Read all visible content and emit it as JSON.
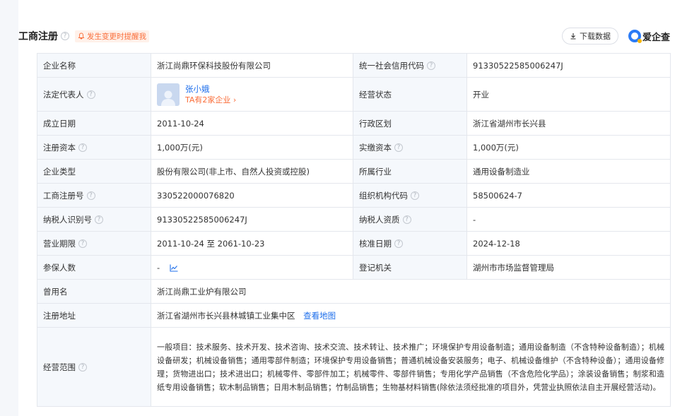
{
  "header": {
    "title": "工商注册",
    "alert": "发生变更时提醒我",
    "download_label": "下载数据",
    "brand": "爱企查"
  },
  "fields": {
    "company_name_label": "企业名称",
    "company_name": "浙江尚鼎环保科技股份有限公司",
    "credit_code_label": "统一社会信用代码",
    "credit_code": "91330522585006247J",
    "legal_rep_label": "法定代表人",
    "legal_rep_name": "张小娥",
    "legal_rep_companies": "TA有2家企业 ›",
    "status_label": "经营状态",
    "status": "开业",
    "founded_label": "成立日期",
    "founded": "2011-10-24",
    "region_label": "行政区划",
    "region": "浙江省湖州市长兴县",
    "reg_capital_label": "注册资本",
    "reg_capital": "1,000万(元)",
    "paid_capital_label": "实缴资本",
    "paid_capital": "1,000万(元)",
    "type_label": "企业类型",
    "type": "股份有限公司(非上市、自然人投资或控股)",
    "industry_label": "所属行业",
    "industry": "通用设备制造业",
    "reg_no_label": "工商注册号",
    "reg_no": "330522000076820",
    "org_code_label": "组织机构代码",
    "org_code": "58500624-7",
    "tax_id_label": "纳税人识别号",
    "tax_id": "91330522585006247J",
    "taxpayer_qual_label": "纳税人资质",
    "taxpayer_qual": "-",
    "term_label": "营业期限",
    "term": "2011-10-24 至 2061-10-23",
    "approval_label": "核准日期",
    "approval": "2024-12-18",
    "insured_label": "参保人数",
    "insured": "-",
    "authority_label": "登记机关",
    "authority": "湖州市市场监督管理局",
    "former_name_label": "曾用名",
    "former_name": "浙江尚鼎工业炉有限公司",
    "address_label": "注册地址",
    "address": "浙江省湖州市长兴县林城镇工业集中区",
    "map_link": "查看地图",
    "scope_label": "经营范围",
    "scope": "一般项目：技术服务、技术开发、技术咨询、技术交流、技术转让、技术推广；环境保护专用设备制造；通用设备制造（不含特种设备制造）；机械设备研发；机械设备销售；通用零部件制造；环境保护专用设备销售；普通机械设备安装服务；电子、机械设备维护（不含特种设备）；通用设备修理；货物进出口；技术进出口；机械零件、零部件加工；机械零件、零部件销售；专用化学产品销售（不含危险化学品）；涂装设备销售；制浆和造纸专用设备销售；软木制品销售；日用木制品销售；竹制品销售；生物基材料销售(除依法须经批准的项目外，凭营业执照依法自主开展经营活动)。"
  },
  "colors": {
    "link": "#1f6feb",
    "alert": "#fa6e3a",
    "label_bg": "#f5f8fc",
    "border": "#e4e7ed"
  }
}
